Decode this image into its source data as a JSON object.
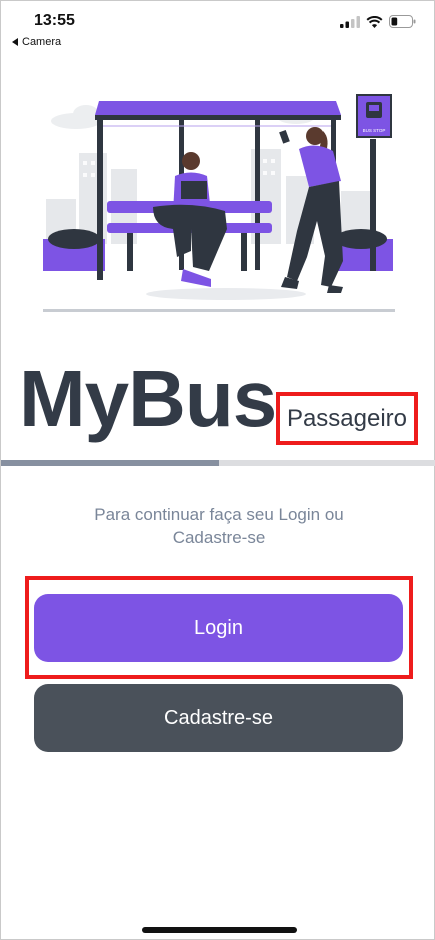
{
  "status_bar": {
    "time": "13:55",
    "back_label": "Camera",
    "back_icon": "chevron-left-icon",
    "signal_icon": "cellular-signal-icon",
    "wifi_icon": "wifi-icon",
    "battery_icon": "battery-icon",
    "battery_level": 0.3
  },
  "illustration": {
    "sign_text": "BUS STOP",
    "accent_color": "#7d54e4"
  },
  "brand": {
    "title": "MyBus",
    "role_label": "Passageiro"
  },
  "progress": {
    "value": 0.5
  },
  "subtitle": "Para continuar faça seu Login ou Cadastre-se",
  "buttons": {
    "login_label": "Login",
    "register_label": "Cadastre-se"
  },
  "colors": {
    "primary": "#7d54e4",
    "secondary": "#4a515a",
    "highlight": "#ee1c1c",
    "title": "#333b47"
  }
}
